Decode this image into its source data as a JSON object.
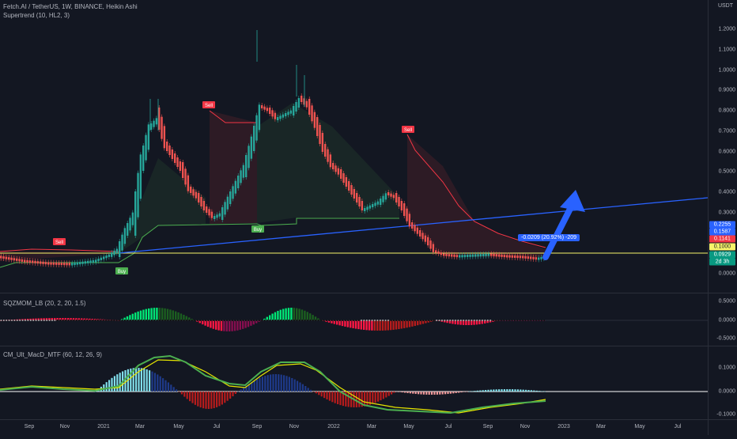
{
  "header": {
    "symbol_line": "Fetch.AI / TetherUS, 1W, BINANCE, Heikin Ashi",
    "indicator": "Supertrend (10, HL2, 3)"
  },
  "pane2": {
    "title": "SQZMOM_LB (20, 2, 20, 1.5)"
  },
  "pane3": {
    "title": "CM_Ult_MacD_MTF (60, 12, 26, 9)"
  },
  "price_axis": {
    "currency": "USDT",
    "labels": [
      "1.2000",
      "1.1000",
      "1.0000",
      "0.9000",
      "0.8000",
      "0.7000",
      "0.6000",
      "0.5000",
      "0.4000",
      "0.3000",
      "0.0000"
    ],
    "tags": [
      {
        "text": "0.2255",
        "color": "#2962ff"
      },
      {
        "text": "0.1587",
        "color": "#2962ff"
      },
      {
        "text": "0.1141",
        "color": "#f23645"
      },
      {
        "text": "0.1000",
        "color": "#f7f56a",
        "textColor": "#131722"
      },
      {
        "text": "0.0929",
        "color": "#089981"
      },
      {
        "text": "2d 3h",
        "color": "#089981"
      }
    ]
  },
  "pane2_axis": [
    "0.5000",
    "0.0000",
    "-0.5000"
  ],
  "pane3_axis": [
    "0.1000",
    "0.0000",
    "-0.1000"
  ],
  "time_axis": [
    "Sep",
    "Nov",
    "2021",
    "Mar",
    "May",
    "Jul",
    "Sep",
    "Nov",
    "2022",
    "Mar",
    "May",
    "Jul",
    "Sep",
    "Nov",
    "2023",
    "Mar",
    "May",
    "Jul"
  ],
  "signals": {
    "sell": "Sell",
    "buy": "Buy"
  },
  "measure_callout": "-0.0209 (20.92%) -209",
  "chart_data": {
    "type": "candlestick",
    "colors": {
      "up": "#26a69a",
      "down": "#ef5350",
      "supertrend_up": "#4caf50",
      "supertrend_down": "#f23645",
      "trendline": "#2962ff",
      "hline": "#f7f56a"
    }
  }
}
